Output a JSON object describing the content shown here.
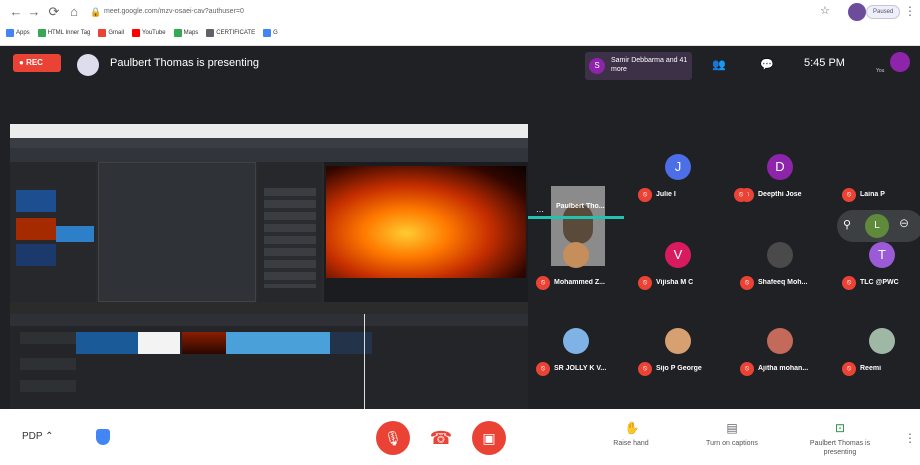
{
  "browser": {
    "url": "meet.google.com/mzv-osaei-cav?authuser=0",
    "bookmarks": [
      {
        "label": "Apps",
        "color": "#4285f4"
      },
      {
        "label": "HTML Inner Tag",
        "color": "#34a853"
      },
      {
        "label": "Gmail",
        "color": "#ea4335"
      },
      {
        "label": "YouTube",
        "color": "#ff0000"
      },
      {
        "label": "Maps",
        "color": "#34a853"
      },
      {
        "label": "CERTIFICATE",
        "color": "#5f6368"
      },
      {
        "label": "G",
        "color": "#4285f4"
      }
    ],
    "profile_label": "Paused"
  },
  "meet": {
    "rec_label": "REC",
    "presenting_text": "Paulbert Thomas is presenting",
    "participants_chip": "Samir Debbarma and 41 more",
    "time": "5:45 PM",
    "you_label": "You",
    "tiles": [
      {
        "name": "Paulbert Tho...",
        "initial": "",
        "color": "#8b8b8b",
        "type": "video"
      },
      {
        "name": "Julie I",
        "initial": "J",
        "color": "#4c6ee6",
        "type": "avatar"
      },
      {
        "name": "Deepthi Jose",
        "initial": "D",
        "color": "#8e24aa",
        "type": "avatar"
      },
      {
        "name": "Laina P",
        "initial": "L",
        "color": "#5f8a3c",
        "type": "avatar"
      },
      {
        "name": "Mohammed Z...",
        "initial": "",
        "color": "#c68e5a",
        "type": "photo"
      },
      {
        "name": "Vijisha M C",
        "initial": "V",
        "color": "#d81b60",
        "type": "avatar"
      },
      {
        "name": "Shafeeq Moh...",
        "initial": "",
        "color": "#4a4a4a",
        "type": "photo"
      },
      {
        "name": "TLC @PWC",
        "initial": "T",
        "color": "#9c5bd6",
        "type": "avatar"
      },
      {
        "name": "SR JOLLY K V...",
        "initial": "",
        "color": "#7fb3e6",
        "type": "photo"
      },
      {
        "name": "Sijo P George",
        "initial": "",
        "color": "#d6a070",
        "type": "photo"
      },
      {
        "name": "Ajitha mohan...",
        "initial": "",
        "color": "#c46a5a",
        "type": "photo"
      },
      {
        "name": "Reemi",
        "initial": "",
        "color": "#9fb8a6",
        "type": "photo"
      }
    ],
    "bottom": {
      "meeting_code": "PDP",
      "raise_hand": "Raise hand",
      "captions": "Turn on captions",
      "present_now": "Paulbert Thomas is presenting"
    }
  },
  "colors": {
    "meet_bg": "#202124",
    "red": "#ea4335",
    "rec_red": "#ea4335"
  }
}
